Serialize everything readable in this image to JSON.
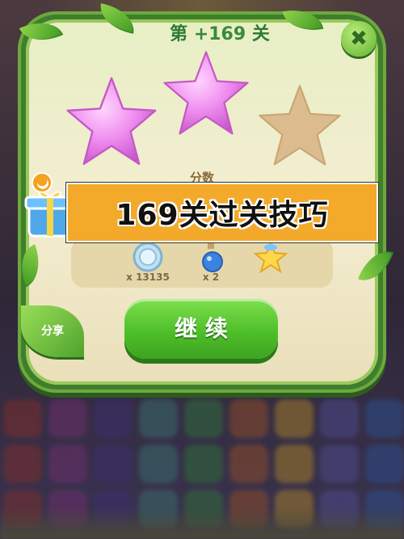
{
  "level_title": {
    "prefix": "第",
    "number": "+169",
    "suffix": "关"
  },
  "stars": {
    "earned": 2,
    "total": 3
  },
  "score_label": "分数",
  "banner_text": "169关过关技巧",
  "rewards": [
    {
      "icon": "coin-icon",
      "count": "x 13135"
    },
    {
      "icon": "potion-bottle-icon",
      "count": "x 2"
    },
    {
      "icon": "star-fairy-icon",
      "count": ""
    }
  ],
  "buttons": {
    "continue": "继 续",
    "share": "分享",
    "close": "✖"
  },
  "colors": {
    "frame_green": "#3f7f2c",
    "star_pink": "#e57ce6",
    "star_empty": "#d7b98c",
    "continue_green": "#4fbf2a",
    "banner_orange": "#f3a92a"
  }
}
